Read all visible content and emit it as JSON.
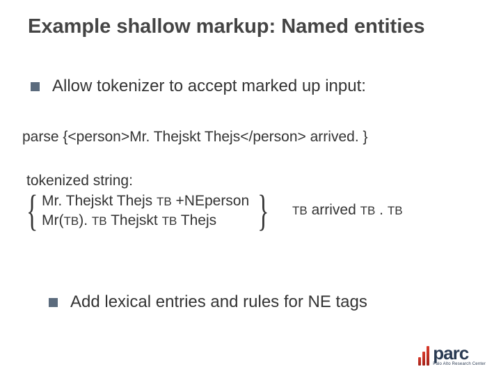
{
  "title": "Example shallow markup: Named entities",
  "bullet1": "Allow tokenizer to accept marked up input:",
  "parse_line": "parse {<person>Mr. Thejskt Thejs</person> arrived. }",
  "tokenized_label": "tokenized string:",
  "tok_line1_a": "Mr. Thejskt Thejs ",
  "tok_line1_tb": "TB",
  "tok_line1_b": " +NEperson",
  "tok_line2_a": "Mr(",
  "tok_line2_tb1": "TB",
  "tok_line2_b": "). ",
  "tok_line2_tb2": "TB",
  "tok_line2_c": " Thejskt ",
  "tok_line2_tb3": "TB",
  "tok_line2_d": " Thejs",
  "after_tb1": "TB",
  "after_a": " arrived ",
  "after_tb2": "TB",
  "after_b": " . ",
  "after_tb3": "TB",
  "bullet2": "Add lexical entries and rules for NE tags",
  "logo": {
    "main": "parc",
    "sub": "Palo Alto Research Center"
  }
}
